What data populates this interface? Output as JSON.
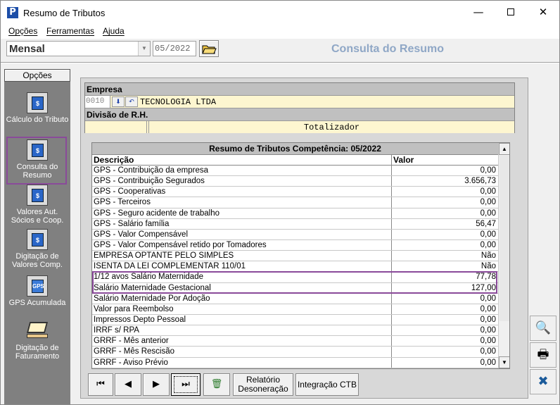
{
  "window": {
    "title": "Resumo de Tributos",
    "icon_letter": "P"
  },
  "menu": [
    "Opções",
    "Ferramentas",
    "Ajuda"
  ],
  "toolbar": {
    "period": "Mensal",
    "date": "05/2022",
    "header_title": "Consulta do Resumo"
  },
  "sidebar": {
    "header": "Opções",
    "items": [
      {
        "label": "Cálculo do Tributo",
        "icon_text": "$"
      },
      {
        "label": "Consulta do Resumo",
        "icon_text": "$"
      },
      {
        "label": "Valores Aut. Sócios e Coop.",
        "icon_text": "$"
      },
      {
        "label": "Digitação de Valores Comp.",
        "icon_text": "$"
      },
      {
        "label": "GPS Acumulada",
        "icon_text": "GPS"
      },
      {
        "label": "Digitação de Faturamento",
        "icon_text": ""
      }
    ]
  },
  "empresa": {
    "label": "Empresa",
    "code": "0010",
    "name": "TECNOLOGIA LTDA",
    "divisao_label": "Divisão de R.H.",
    "totalizador": "Totalizador"
  },
  "grid": {
    "title": "Resumo de Tributos Competência: 05/2022",
    "headers": [
      "Descrição",
      "Valor"
    ],
    "rows": [
      [
        "GPS - Contribuição da empresa",
        "0,00"
      ],
      [
        "GPS - Contribuição Segurados",
        "3.656,73"
      ],
      [
        "GPS - Cooperativas",
        "0,00"
      ],
      [
        "GPS - Terceiros",
        "0,00"
      ],
      [
        "GPS - Seguro acidente de trabalho",
        "0,00"
      ],
      [
        "GPS - Salário família",
        "56,47"
      ],
      [
        "GPS - Valor Compensável",
        "0,00"
      ],
      [
        "GPS - Valor Compensável retido por Tomadores",
        "0,00"
      ],
      [
        "EMPRESA OPTANTE PELO SIMPLES",
        "Não"
      ],
      [
        "ISENTA DA LEI COMPLEMENTAR 110/01",
        "Não"
      ],
      [
        "1/12 avos Salário Maternidade",
        "77,78"
      ],
      [
        "Salário Maternidade Gestacional",
        "127,00"
      ],
      [
        "Salário Maternidade Por Adoção",
        "0,00"
      ],
      [
        "Valor para Reembolso",
        "0,00"
      ],
      [
        "Impressos Depto Pessoal",
        "0,00"
      ],
      [
        "IRRF s/ RPA",
        "0,00"
      ],
      [
        "GRRF - Mês anterior",
        "0,00"
      ],
      [
        "GRRF - Mês Rescisão",
        "0,00"
      ],
      [
        "GRRF - Aviso Prévio",
        "0,00"
      ]
    ]
  },
  "nav": {
    "relatorio": "Relatório Desoneração",
    "integracao": "Integração CTB"
  }
}
